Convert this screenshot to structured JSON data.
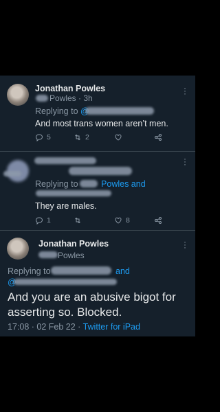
{
  "tweet1": {
    "name": "Jonathan Powles",
    "handle_suffix": "Powles",
    "time": "· 3h",
    "replying_prefix": "Replying to",
    "mention_visible": "@",
    "text": "And most trans women aren’t men.",
    "actions": {
      "replies": "5",
      "retweets": "2",
      "likes": ""
    },
    "icons": [
      "reply-icon",
      "retweet-icon",
      "like-icon",
      "share-icon",
      "more-icon"
    ]
  },
  "tweet2": {
    "replying_prefix": "Replying to",
    "mention_visible": "Powles and",
    "text": "They are males.",
    "actions": {
      "replies": "1",
      "retweets": "",
      "likes": "8"
    }
  },
  "tweet3": {
    "name": "Jonathan Powles",
    "handle_suffix": "Powles",
    "replying_prefix": "Replying to",
    "mention_and": "and",
    "mention_second_prefix": "@",
    "text": "And you are an abusive bigot for asserting so.  Blocked.",
    "timestamp": "17:08 · 02 Feb 22 · ",
    "source": "Twitter for iPad"
  },
  "colors": {
    "background": "#15202b",
    "text": "#e7e9ea",
    "secondary": "#8b98a5",
    "accent": "#1d9bf0",
    "divider": "#38444d"
  }
}
